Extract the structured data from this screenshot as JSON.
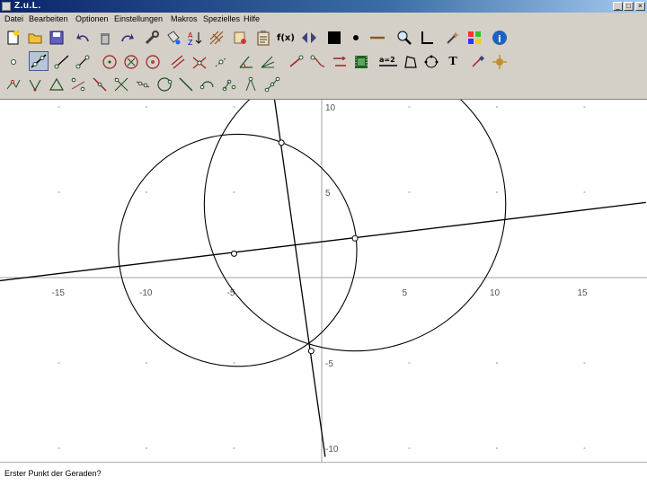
{
  "window": {
    "title": "Z.u.L.",
    "minimize_label": "_",
    "maximize_label": "□",
    "close_label": "×"
  },
  "menu": [
    "Datei",
    "Bearbeiten",
    "Optionen",
    "Einstellungen",
    "Makros",
    "Spezielles",
    "Hilfe"
  ],
  "toolbar": {
    "function_label": "f(x)",
    "text_tool_label": "T",
    "ratio_label": "a=2"
  },
  "graph": {
    "x_ticks": [
      {
        "label": "-15",
        "value": -15
      },
      {
        "label": "-10",
        "value": -10
      },
      {
        "label": "-5",
        "value": -5
      },
      {
        "label": "5",
        "value": 5
      },
      {
        "label": "10",
        "value": 10
      },
      {
        "label": "15",
        "value": 15
      }
    ],
    "y_ticks": [
      {
        "label": "10",
        "value": 10
      },
      {
        "label": "5",
        "value": 5
      },
      {
        "label": "-5",
        "value": -5
      },
      {
        "label": "-10",
        "value": -10
      }
    ],
    "x_range": [
      -18.5,
      18.5
    ],
    "y_range": [
      -10,
      10.5
    ],
    "grid": true,
    "circles": [
      {
        "cx": -4.8,
        "cy": 1.6,
        "r": 6.8
      },
      {
        "cx": 1.9,
        "cy": 4.3,
        "r": 8.6
      }
    ],
    "lines": [
      {
        "p1": [
          -18.5,
          -0.2
        ],
        "p2": [
          18.5,
          4.4
        ]
      },
      {
        "p1": [
          -2.7,
          10.5
        ],
        "p2": [
          0.2,
          -10.5
        ]
      }
    ],
    "points": [
      {
        "x": -2.3,
        "y": 7.9
      },
      {
        "x": -0.6,
        "y": -4.3
      },
      {
        "x": -5.0,
        "y": 1.4
      },
      {
        "x": 1.9,
        "y": 2.3
      }
    ]
  },
  "status": {
    "text": "Erster Punkt der Geraden?"
  }
}
